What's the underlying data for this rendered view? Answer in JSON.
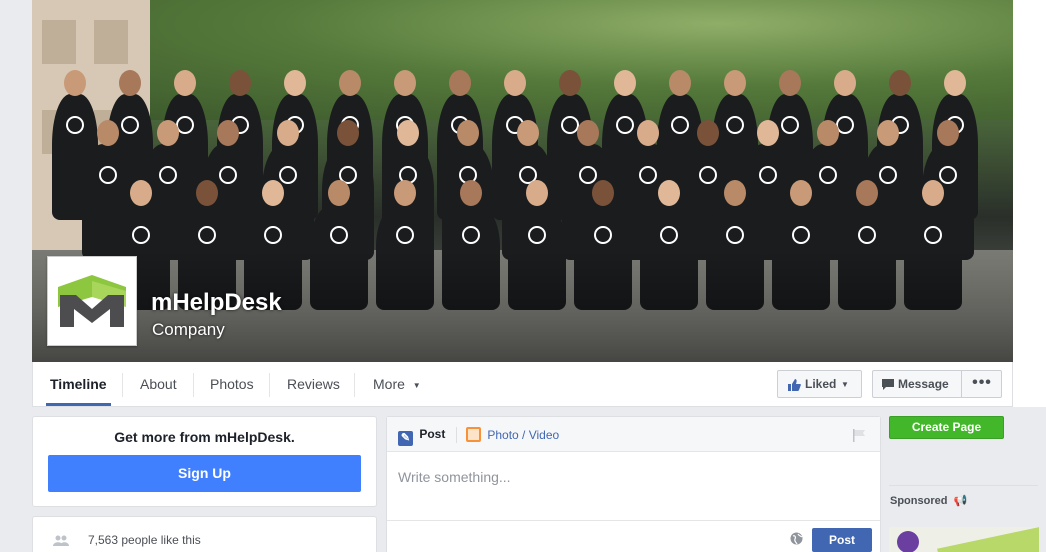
{
  "page": {
    "name": "mHelpDesk",
    "category": "Company"
  },
  "tabs": [
    {
      "label": "Timeline",
      "active": true
    },
    {
      "label": "About"
    },
    {
      "label": "Photos"
    },
    {
      "label": "Reviews"
    },
    {
      "label": "More"
    }
  ],
  "actions": {
    "liked_label": "Liked",
    "message_label": "Message"
  },
  "sidebar": {
    "get_more_title": "Get more from mHelpDesk.",
    "signup_label": "Sign Up",
    "likes_text": "7,563 people like this"
  },
  "composer": {
    "post_tab": "Post",
    "photo_tab": "Photo / Video",
    "placeholder": "Write something...",
    "post_button": "Post"
  },
  "right": {
    "create_page_label": "Create Page",
    "sponsored_label": "Sponsored"
  },
  "colors": {
    "brand_blue": "#4267b2",
    "signup_blue": "#4080ff",
    "create_green": "#42b72a",
    "logo_green": "#8dc63f",
    "logo_gray": "#4d4d4f"
  }
}
